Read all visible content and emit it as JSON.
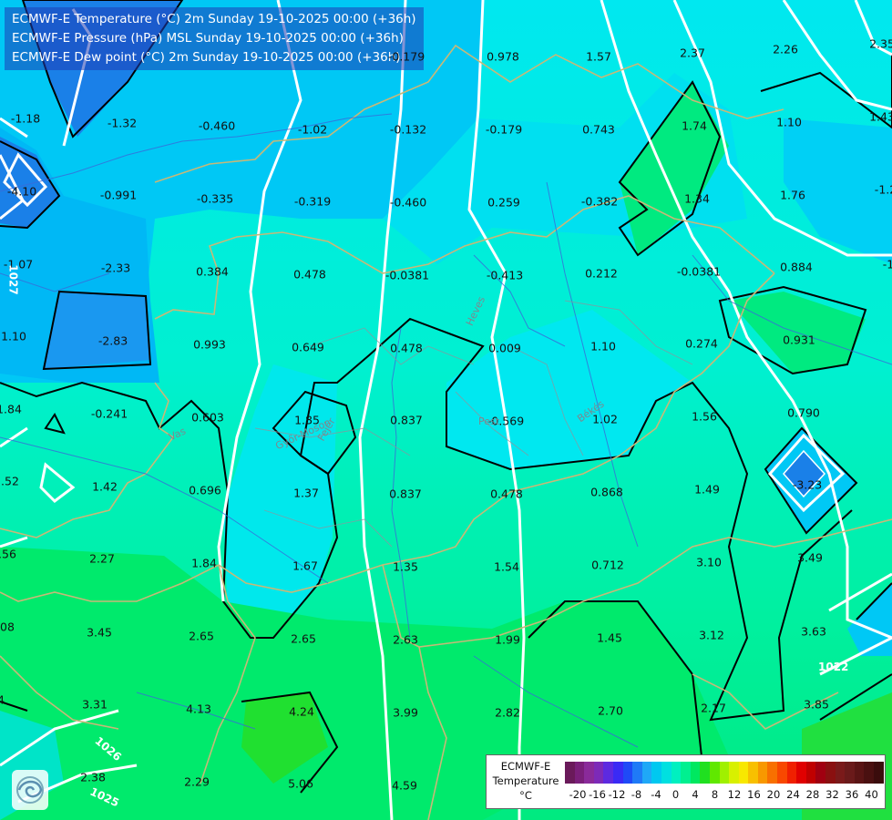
{
  "titles": [
    "ECMWF-E Temperature (°C) 2m Sunday 19-10-2025 00:00 (+36h)",
    "ECMWF-E Pressure (hPa) MSL Sunday 19-10-2025 00:00 (+36h)",
    "ECMWF-E Dew point (°C) 2m Sunday 19-10-2025 00:00 (+36h)"
  ],
  "values": [
    {
      "t": "-0.179"
    },
    {
      "t": "0.978"
    },
    {
      "t": "1.57"
    },
    {
      "t": "2.37"
    },
    {
      "t": "2.26"
    },
    {
      "t": "2.35"
    },
    {
      "t": "-1.18"
    },
    {
      "t": "-1.32"
    },
    {
      "t": "-0.460"
    },
    {
      "t": "-1.02"
    },
    {
      "t": "-0.132"
    },
    {
      "t": "-0.179"
    },
    {
      "t": "0.743"
    },
    {
      "t": "1.74"
    },
    {
      "t": "1.10"
    },
    {
      "t": "1.43"
    },
    {
      "t": "-4.10"
    },
    {
      "t": "-0.991"
    },
    {
      "t": "-0.335"
    },
    {
      "t": "-0.319"
    },
    {
      "t": "-0.460"
    },
    {
      "t": "0.259"
    },
    {
      "t": "-0.382"
    },
    {
      "t": "1.34"
    },
    {
      "t": "1.76"
    },
    {
      "t": "-1.2"
    },
    {
      "t": "-1.07"
    },
    {
      "t": "-2.33"
    },
    {
      "t": "0.384"
    },
    {
      "t": "0.478"
    },
    {
      "t": "-0.0381"
    },
    {
      "t": "-0.413"
    },
    {
      "t": "0.212"
    },
    {
      "t": "-0.0381"
    },
    {
      "t": "0.884"
    },
    {
      "t": "-1"
    },
    {
      "t": "1.10"
    },
    {
      "t": "-2.83"
    },
    {
      "t": "0.993"
    },
    {
      "t": "0.649"
    },
    {
      "t": "0.478"
    },
    {
      "t": "0.009"
    },
    {
      "t": "1.10"
    },
    {
      "t": "0.274"
    },
    {
      "t": "0.931"
    },
    {
      "t": "1.84"
    },
    {
      "t": "-0.241"
    },
    {
      "t": "0.603"
    },
    {
      "t": "1.85"
    },
    {
      "t": "0.837"
    },
    {
      "t": "-0.569"
    },
    {
      "t": "1.02"
    },
    {
      "t": "1.56"
    },
    {
      "t": "0.790"
    },
    {
      "t": "1.52"
    },
    {
      "t": "1.42"
    },
    {
      "t": "0.696"
    },
    {
      "t": "1.37"
    },
    {
      "t": "0.837"
    },
    {
      "t": "0.478"
    },
    {
      "t": "0.868"
    },
    {
      "t": "1.49"
    },
    {
      "t": "-3.23"
    },
    {
      "t": "2.56"
    },
    {
      "t": "2.27"
    },
    {
      "t": "1.84"
    },
    {
      "t": "1.67"
    },
    {
      "t": "1.35"
    },
    {
      "t": "1.54"
    },
    {
      "t": "0.712"
    },
    {
      "t": "3.10"
    },
    {
      "t": "3.49"
    },
    {
      "t": "3.08"
    },
    {
      "t": "3.45"
    },
    {
      "t": "2.65"
    },
    {
      "t": "2.65"
    },
    {
      "t": "2.63"
    },
    {
      "t": "1.99"
    },
    {
      "t": "1.45"
    },
    {
      "t": "3.12"
    },
    {
      "t": "3.63"
    },
    {
      "t": "4"
    },
    {
      "t": "3.31"
    },
    {
      "t": "4.13"
    },
    {
      "t": "4.24"
    },
    {
      "t": "3.99"
    },
    {
      "t": "2.82"
    },
    {
      "t": "2.70"
    },
    {
      "t": "2.17"
    },
    {
      "t": "3.85"
    },
    {
      "t": "2.38"
    },
    {
      "t": "2.29"
    },
    {
      "t": "5.06"
    },
    {
      "t": "4.59"
    }
  ],
  "isobar_labels": [
    "1022",
    "1026",
    "1025",
    "1027"
  ],
  "region_labels": [
    "Heves",
    "Békés",
    "Vas",
    "Győr-Moson",
    "Pest",
    "Fejér"
  ],
  "legend": {
    "label_lines": [
      "ECMWF-E",
      "Temperature",
      "°C"
    ],
    "ticks": [
      "-20",
      "-16",
      "-12",
      "-8",
      "-4",
      "0",
      "4",
      "8",
      "12",
      "16",
      "20",
      "24",
      "28",
      "32",
      "36",
      "40"
    ],
    "colors": [
      "#6a1a5a",
      "#7a1f7a",
      "#8a2a9a",
      "#7d2ab8",
      "#5d2ae0",
      "#3a2af5",
      "#1f4af7",
      "#1f7af7",
      "#1fa8f7",
      "#00c8f0",
      "#00e0e0",
      "#00f0c0",
      "#00f090",
      "#00e860",
      "#20e020",
      "#60e800",
      "#a0f000",
      "#d8f000",
      "#f8e800",
      "#f8c000",
      "#f89800",
      "#f87000",
      "#f84800",
      "#f02000",
      "#e00000",
      "#c00000",
      "#a00010",
      "#8a1010",
      "#7a1a1a",
      "#6a1a1a",
      "#5a1414",
      "#4a1010",
      "#3a0c0c"
    ]
  }
}
